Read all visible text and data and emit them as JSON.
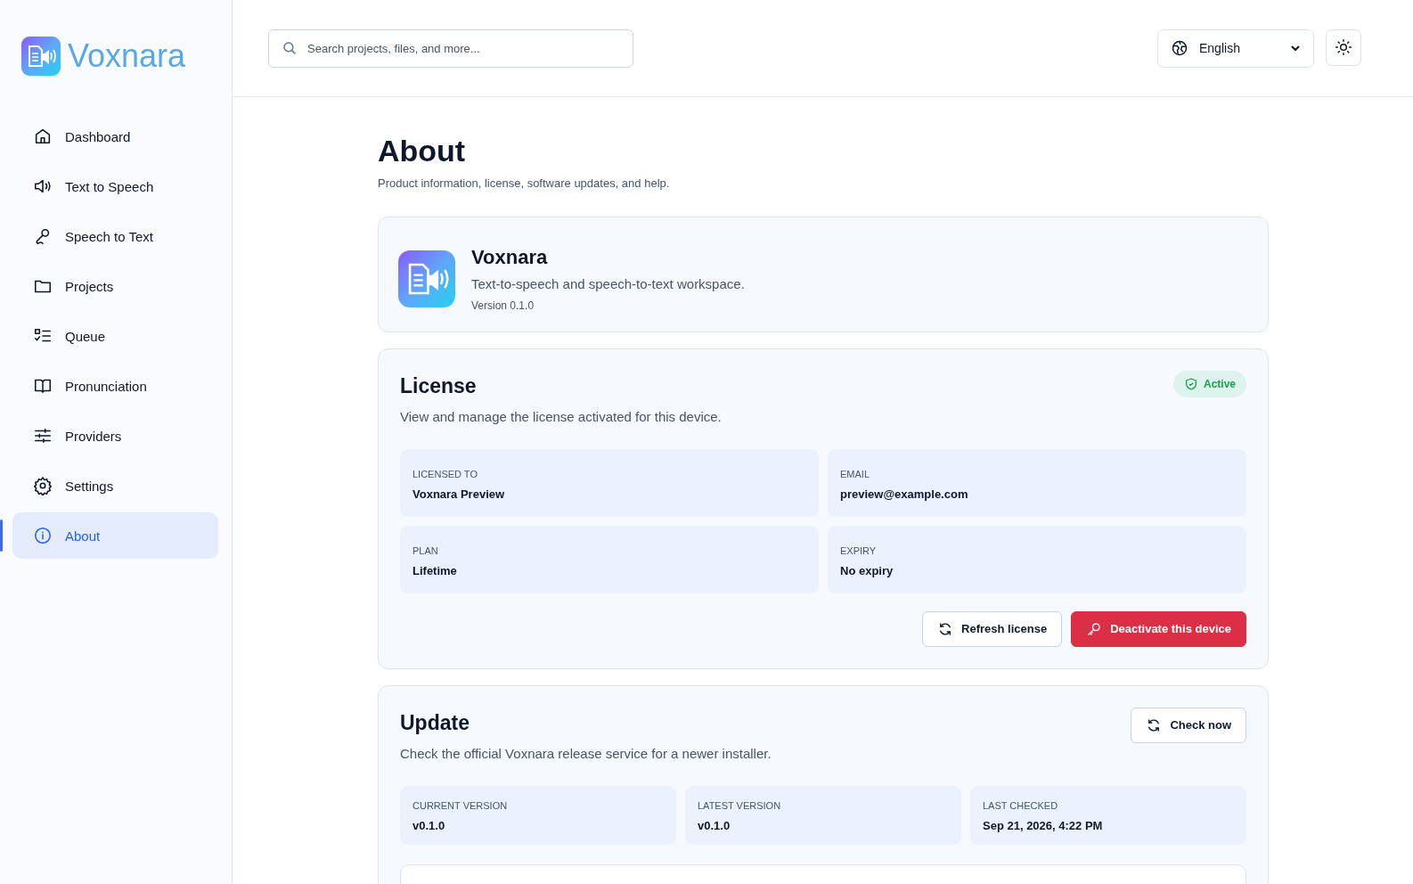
{
  "brand": {
    "name": "Voxnara"
  },
  "sidebar": {
    "items": [
      {
        "label": "Dashboard",
        "selected": false
      },
      {
        "label": "Text to Speech",
        "selected": false
      },
      {
        "label": "Speech to Text",
        "selected": false
      },
      {
        "label": "Projects",
        "selected": false
      },
      {
        "label": "Queue",
        "selected": false
      },
      {
        "label": "Pronunciation",
        "selected": false
      },
      {
        "label": "Providers",
        "selected": false
      },
      {
        "label": "Settings",
        "selected": false
      },
      {
        "label": "About",
        "selected": true
      }
    ]
  },
  "header": {
    "search": {
      "placeholder": "Search projects, files, and more..."
    },
    "language": "English"
  },
  "page": {
    "title": "About",
    "subtitle": "Product information, license, software updates, and help."
  },
  "product": {
    "name": "Voxnara",
    "tagline": "Text-to-speech and speech-to-text workspace.",
    "version": "Version 0.1.0"
  },
  "license": {
    "title": "License",
    "description": "View and manage the license activated for this device.",
    "status": "Active",
    "fields": [
      {
        "label": "LICENSED TO",
        "value": "Voxnara Preview"
      },
      {
        "label": "EMAIL",
        "value": "preview@example.com"
      },
      {
        "label": "PLAN",
        "value": "Lifetime"
      },
      {
        "label": "EXPIRY",
        "value": "No expiry"
      }
    ],
    "buttons": [
      {
        "label": "Refresh license",
        "kind": "secondary"
      },
      {
        "label": "Deactivate this device",
        "kind": "danger"
      }
    ]
  },
  "update": {
    "title": "Update",
    "description": "Check the official Voxnara release service for a newer installer.",
    "button": "Check now",
    "fields": [
      {
        "label": "CURRENT VERSION",
        "value": "v0.1.0"
      },
      {
        "label": "LATEST VERSION",
        "value": "v0.1.0"
      },
      {
        "label": "LAST CHECKED",
        "value": "Sep 21, 2026, 4:22 PM"
      }
    ]
  }
}
